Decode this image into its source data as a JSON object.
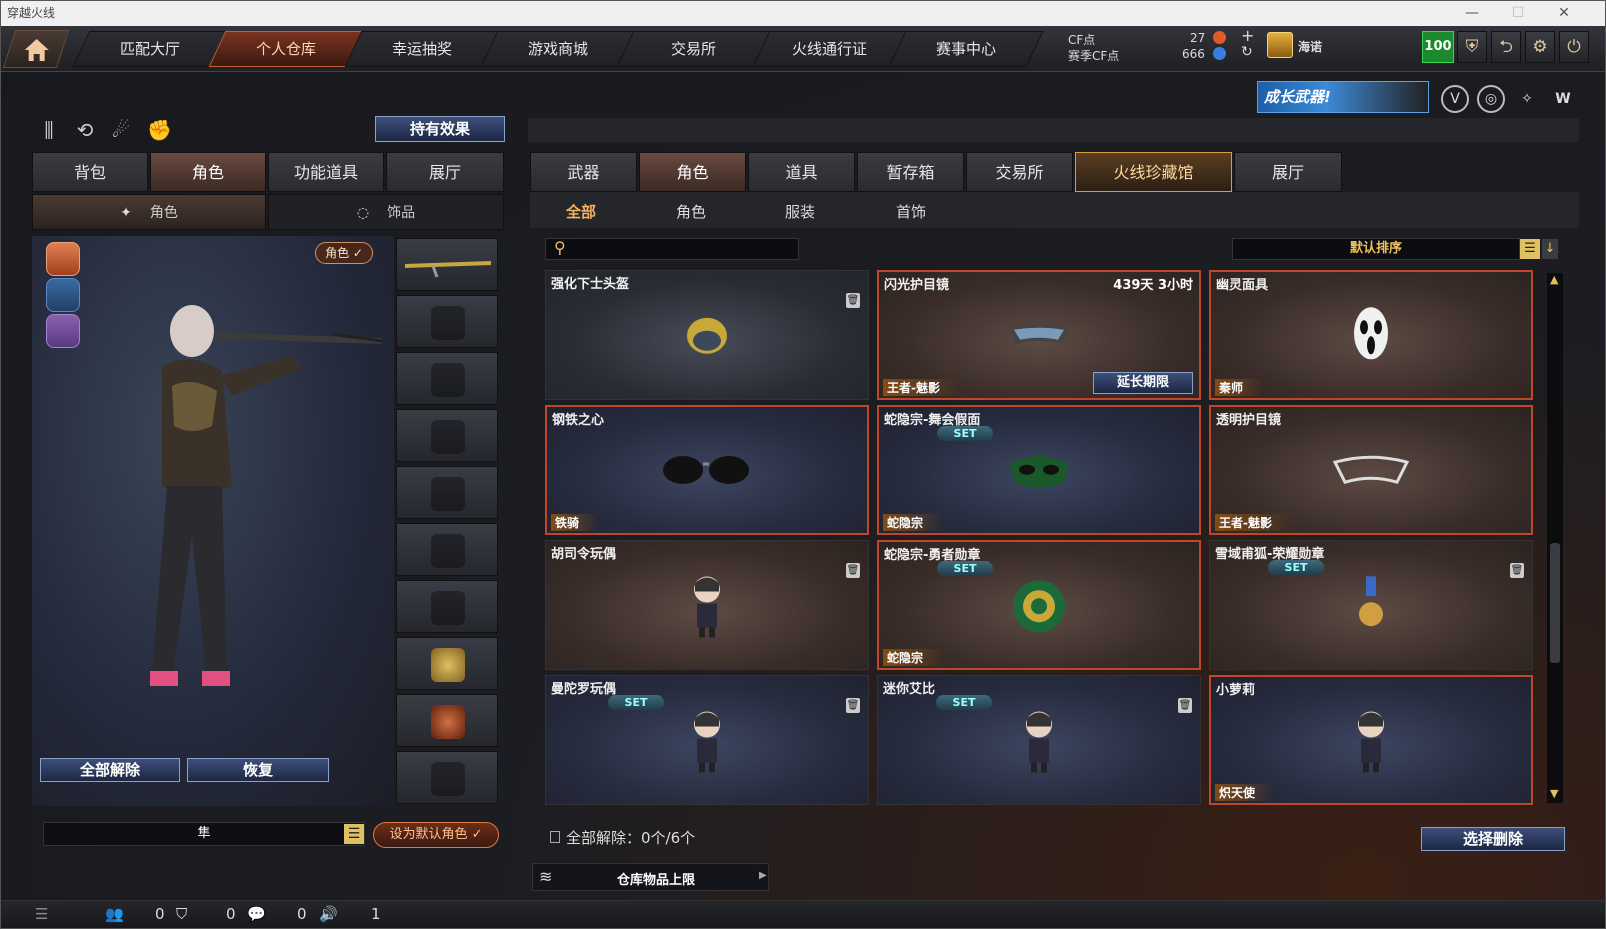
{
  "window": {
    "title": "穿越火线",
    "minimize": "—",
    "maximize": "☐",
    "close": "✕"
  },
  "nav": {
    "tabs": [
      {
        "label": "匹配大厅"
      },
      {
        "label": "个人仓库"
      },
      {
        "label": "幸运抽奖"
      },
      {
        "label": "游戏商城"
      },
      {
        "label": "交易所"
      },
      {
        "label": "火线通行证"
      },
      {
        "label": "赛事中心"
      }
    ],
    "active": "个人仓库"
  },
  "currency": {
    "cf_label": "CF点",
    "cf_value": "27",
    "event_cf_label": "赛季CF点",
    "event_cf_value": "666"
  },
  "user": {
    "name": "海诺",
    "level_badge": "100"
  },
  "banner": {
    "text": "成长武器!"
  },
  "left": {
    "effect_button": "持有效果",
    "tabs": [
      "背包",
      "角色",
      "功能道具",
      "展厅"
    ],
    "active_tab": "角色",
    "subtabs": [
      "角色",
      "饰品"
    ],
    "char_tag": "角色 ✓",
    "unequip_all": "全部解除",
    "restore": "恢复",
    "char_name": "隼",
    "set_default": "设为默认角色 ✓"
  },
  "right": {
    "tabs": [
      "武器",
      "角色",
      "道具",
      "暂存箱",
      "交易所",
      "火线珍藏馆",
      "展厅"
    ],
    "active_tab": "角色",
    "highlight_tab": "火线珍藏馆",
    "subtabs": [
      "全部",
      "角色",
      "服装",
      "首饰"
    ],
    "active_subtab": "全部",
    "search_placeholder": "",
    "sort_label": "默认排序",
    "items": [
      {
        "name": "强化下士头盔",
        "time": "",
        "group": "",
        "set": false,
        "trash": true,
        "extend": "",
        "style": "gray",
        "selected": false,
        "icon": "helmet-icon"
      },
      {
        "name": "闪光护目镜",
        "time": "439天 3小时",
        "group": "王者-魅影",
        "set": false,
        "trash": false,
        "extend": "延长期限",
        "style": "brown",
        "selected": true,
        "icon": "goggles-icon"
      },
      {
        "name": "幽灵面具",
        "time": "",
        "group": "秦师",
        "set": false,
        "trash": false,
        "extend": "",
        "style": "brown",
        "selected": true,
        "icon": "ghost-mask-icon"
      },
      {
        "name": "钢铁之心",
        "time": "",
        "group": "铁骑",
        "set": false,
        "trash": false,
        "extend": "",
        "style": "navy",
        "selected": true,
        "icon": "sunglasses-icon"
      },
      {
        "name": "蛇隐宗-舞会假面",
        "time": "",
        "group": "蛇隐宗",
        "set": true,
        "trash": false,
        "extend": "",
        "style": "navy",
        "selected": true,
        "icon": "masquerade-mask-icon"
      },
      {
        "name": "透明护目镜",
        "time": "",
        "group": "王者-魅影",
        "set": false,
        "trash": false,
        "extend": "",
        "style": "brown",
        "selected": true,
        "icon": "clear-goggles-icon"
      },
      {
        "name": "胡司令玩偶",
        "time": "",
        "group": "",
        "set": false,
        "trash": true,
        "extend": "",
        "style": "brown",
        "selected": false,
        "icon": "doll-icon"
      },
      {
        "name": "蛇隐宗-勇者勋章",
        "time": "",
        "group": "蛇隐宗",
        "set": true,
        "trash": false,
        "extend": "",
        "style": "brown",
        "selected": true,
        "icon": "medal-icon"
      },
      {
        "name": "雪域甫狐-荣耀勋章",
        "time": "",
        "group": "",
        "set": true,
        "trash": true,
        "extend": "",
        "style": "brown",
        "selected": false,
        "icon": "fox-medal-icon"
      },
      {
        "name": "曼陀罗玩偶",
        "time": "",
        "group": "",
        "set": true,
        "trash": true,
        "extend": "",
        "style": "navy",
        "selected": false,
        "icon": "doll-icon"
      },
      {
        "name": "迷你艾比",
        "time": "",
        "group": "",
        "set": true,
        "trash": true,
        "extend": "",
        "style": "navy",
        "selected": false,
        "icon": "doll-icon"
      },
      {
        "name": "小萝莉",
        "time": "",
        "group": "炽天使",
        "set": false,
        "trash": false,
        "extend": "",
        "style": "navy",
        "selected": true,
        "icon": "doll-icon"
      }
    ],
    "set_label": "SET",
    "unequip_summary": "全部解除：0个/6个",
    "select_delete": "选择删除",
    "storage_limit": "仓库物品上限"
  },
  "status": {
    "v1": "0",
    "v2": "0",
    "v3": "0",
    "v4": "1"
  }
}
